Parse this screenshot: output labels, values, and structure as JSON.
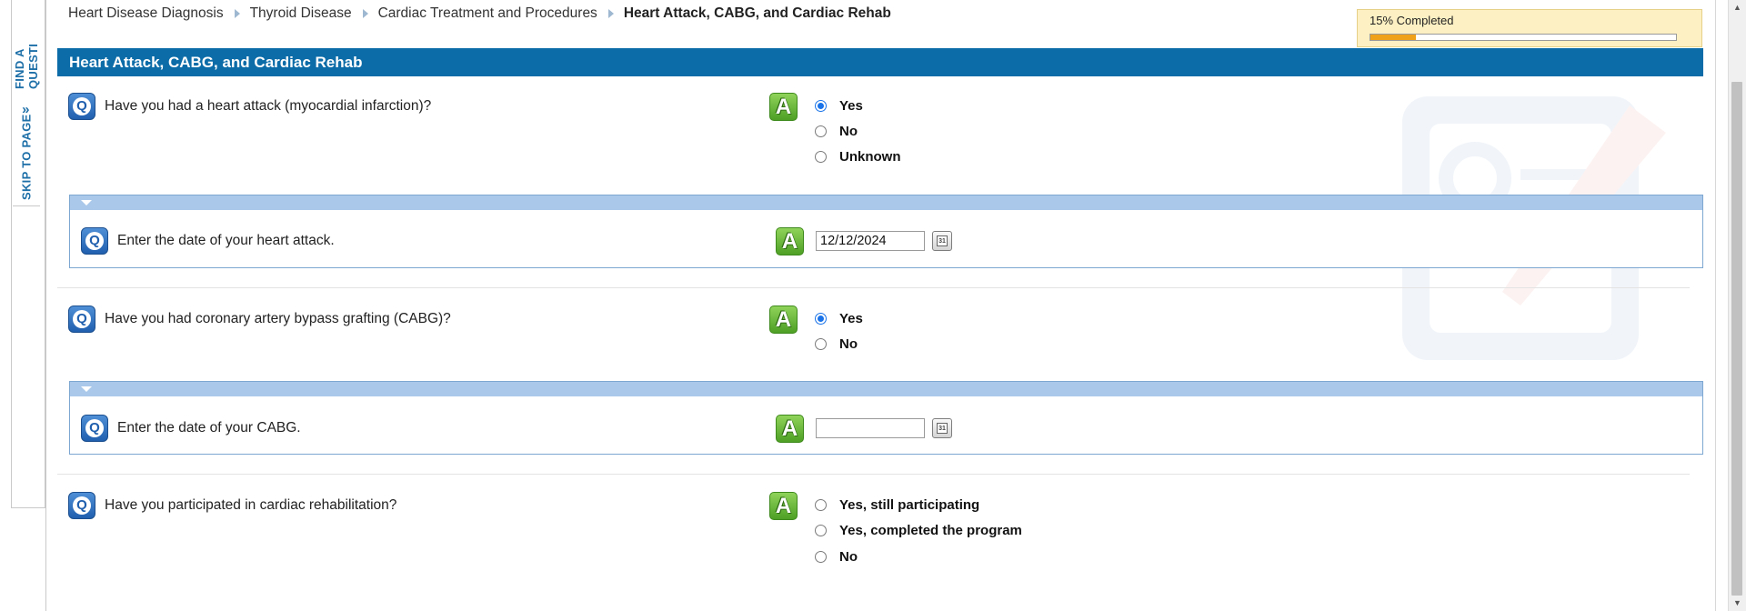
{
  "side_tabs": {
    "find": "FIND A QUESTI",
    "skip": "SKIP TO PAGE"
  },
  "breadcrumb": {
    "items": [
      "Heart Disease Diagnosis",
      "Thyroid Disease",
      "Cardiac Treatment and Procedures"
    ],
    "current": "Heart Attack, CABG, and Cardiac Rehab"
  },
  "progress": {
    "label": "15% Completed",
    "value": 0.15,
    "color": "#f0a11c"
  },
  "section": {
    "title": "Heart Attack, CABG, and Cardiac Rehab",
    "color": "#0b6ca8"
  },
  "icons": {
    "question": "Q",
    "answer": "A",
    "calendar": "31"
  },
  "questions": {
    "q1": {
      "text": "Have you had a heart attack (myocardial infarction)?",
      "options": [
        "Yes",
        "No",
        "Unknown"
      ],
      "selected": "Yes"
    },
    "q1_sub": {
      "text": "Enter the date of your heart attack.",
      "value": "12/12/2024"
    },
    "q2": {
      "text": "Have you had coronary artery bypass grafting (CABG)?",
      "options": [
        "Yes",
        "No"
      ],
      "selected": "Yes"
    },
    "q2_sub": {
      "text": "Enter the date of your CABG.",
      "value": ""
    },
    "q3": {
      "text": "Have you participated in cardiac rehabilitation?",
      "options": [
        "Yes, still participating",
        "Yes, completed the program",
        "No"
      ],
      "selected": null
    }
  }
}
